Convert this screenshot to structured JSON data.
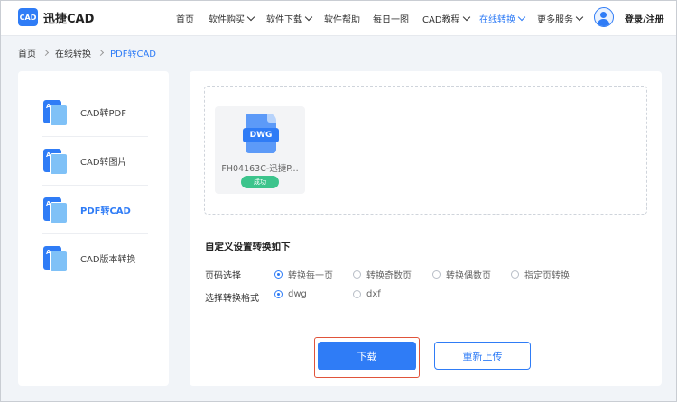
{
  "brand": {
    "logo_badge": "CAD",
    "name": "迅捷CAD",
    "color": "#2f7cf6"
  },
  "nav": [
    {
      "label": "首页",
      "dropdown": false,
      "active": false
    },
    {
      "label": "软件购买",
      "dropdown": true,
      "active": false
    },
    {
      "label": "软件下载",
      "dropdown": true,
      "active": false
    },
    {
      "label": "软件帮助",
      "dropdown": false,
      "active": false
    },
    {
      "label": "每日一图",
      "dropdown": false,
      "active": false
    },
    {
      "label": "CAD教程",
      "dropdown": true,
      "active": false
    },
    {
      "label": "在线转换",
      "dropdown": true,
      "active": true
    },
    {
      "label": "更多服务",
      "dropdown": true,
      "active": false
    }
  ],
  "user": {
    "avatar_icon": "user-avatar-icon",
    "login_label": "登录/注册"
  },
  "breadcrumb": [
    "首页",
    "在线转换",
    "PDF转CAD"
  ],
  "sidebar": {
    "items": [
      {
        "label": "CAD转PDF",
        "icon": "cad-to-pdf-icon",
        "active": false
      },
      {
        "label": "CAD转图片",
        "icon": "cad-to-image-icon",
        "active": false
      },
      {
        "label": "PDF转CAD",
        "icon": "pdf-to-cad-icon",
        "active": true
      },
      {
        "label": "CAD版本转换",
        "icon": "cad-version-convert-icon",
        "active": false
      }
    ]
  },
  "file": {
    "type_label": "DWG",
    "name": "FH04163C-迅捷P...",
    "status": "成功",
    "status_color": "#3cc48c"
  },
  "settings": {
    "title": "自定义设置转换如下",
    "page_select": {
      "label": "页码选择",
      "options": [
        "转换每一页",
        "转换奇数页",
        "转换偶数页",
        "指定页转换"
      ],
      "selected": "转换每一页"
    },
    "format_select": {
      "label": "选择转换格式",
      "options": [
        "dwg",
        "dxf"
      ],
      "selected": "dwg"
    }
  },
  "actions": {
    "download_label": "下载",
    "reupload_label": "重新上传",
    "highlight_color": "#e0533a"
  }
}
